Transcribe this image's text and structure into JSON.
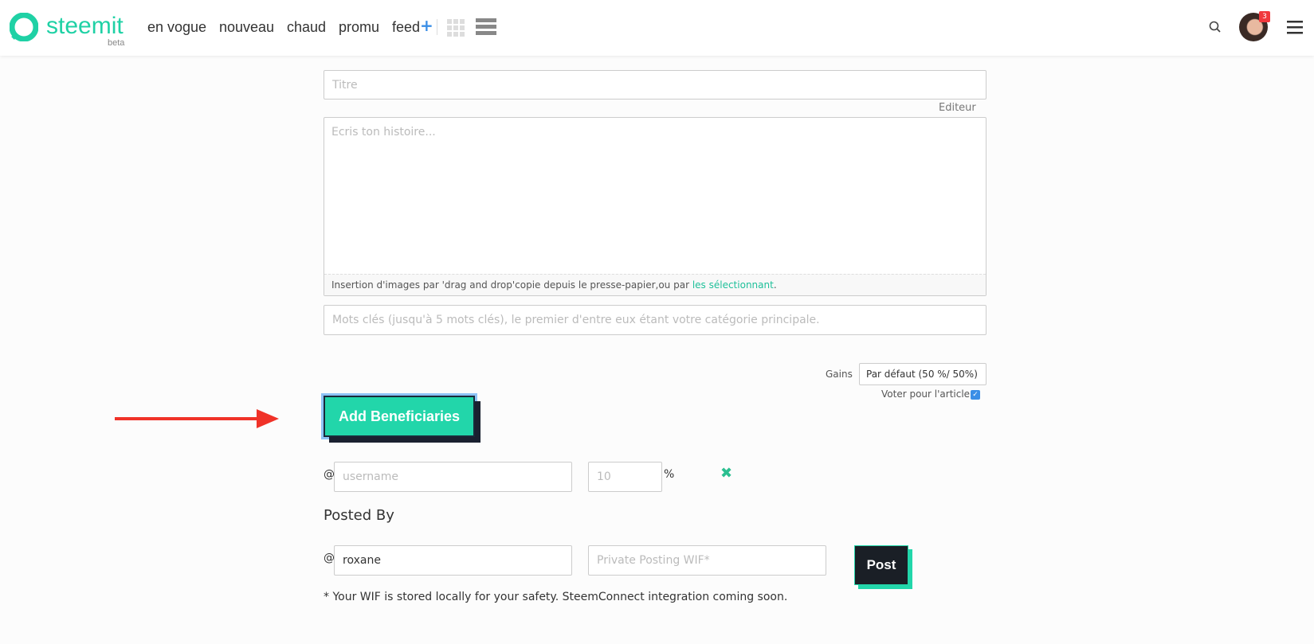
{
  "header": {
    "brand": "steemit",
    "beta": "beta",
    "nav": [
      "en vogue",
      "nouveau",
      "chaud",
      "promu",
      "feed"
    ],
    "notification_count": "3",
    "accent": "#1fd1a5"
  },
  "editor": {
    "title_placeholder": "Titre",
    "editor_toggle": "Editeur",
    "body_placeholder": "Ecris ton histoire...",
    "upload_hint": "Insertion d'images par 'drag and drop'copie depuis le presse-papier,ou par ",
    "upload_link": "les sélectionnant",
    "upload_end": ".",
    "tags_placeholder": "Mots clés (jusqu'à 5 mots clés), le premier d'entre eux étant votre catégorie principale."
  },
  "rewards": {
    "label": "Gains",
    "value": "Par défaut (50 %/ 50%)",
    "vote_label": "Voter pour l'article",
    "vote_checked": true
  },
  "beneficiaries": {
    "button": "Add Beneficiaries",
    "at": "@",
    "username_placeholder": "username",
    "percent_placeholder": "10",
    "percent_sign": "%"
  },
  "posted_by": {
    "heading": "Posted By",
    "at": "@",
    "username": "roxane",
    "wif_placeholder": "Private Posting WIF*",
    "post_button": "Post",
    "note": "* Your WIF is stored locally for your safety. SteemConnect integration coming soon."
  }
}
